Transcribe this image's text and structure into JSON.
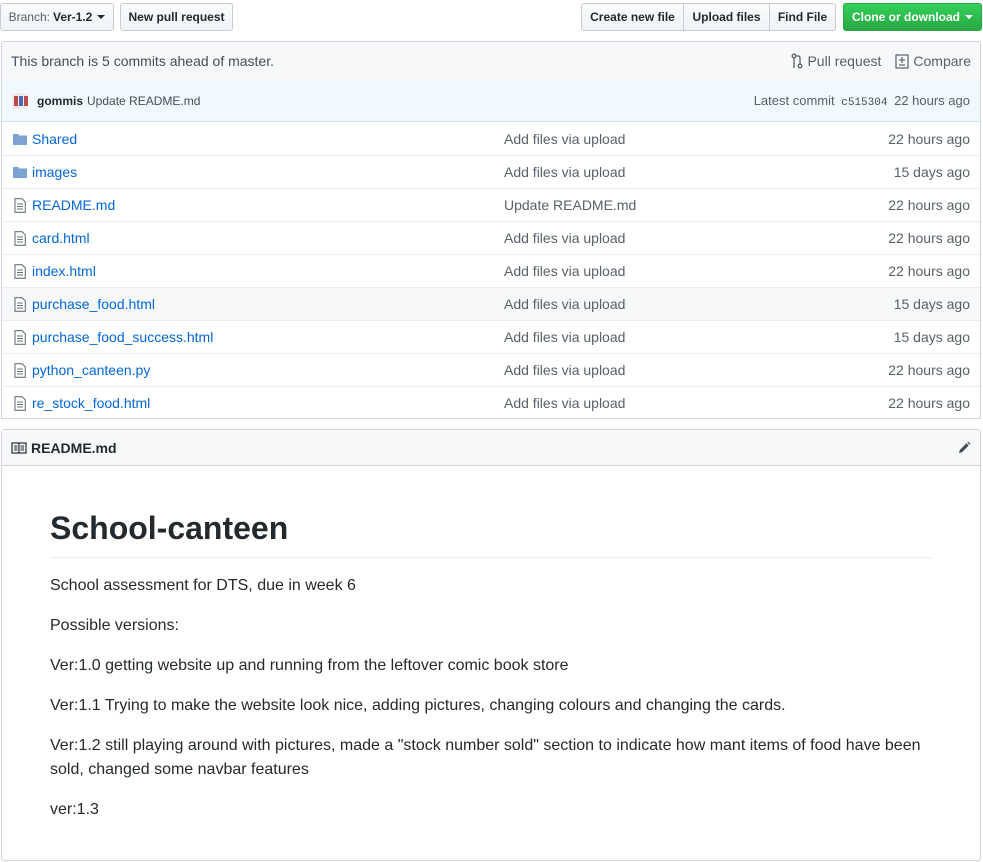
{
  "toolbar": {
    "branch_prefix": "Branch:",
    "branch_name": "Ver-1.2",
    "new_pr": "New pull request",
    "create_file": "Create new file",
    "upload_files": "Upload files",
    "find_file": "Find File",
    "clone": "Clone or download"
  },
  "branch_info": {
    "text": "This branch is 5 commits ahead of master.",
    "pull_request": "Pull request",
    "compare": "Compare"
  },
  "commit": {
    "author": "gommis",
    "message": "Update README.md",
    "latest_label": "Latest commit",
    "sha": "c515304",
    "age": "22 hours ago"
  },
  "files": [
    {
      "type": "folder",
      "name": "Shared",
      "message": "Add files via upload",
      "age": "22 hours ago"
    },
    {
      "type": "folder",
      "name": "images",
      "message": "Add files via upload",
      "age": "15 days ago"
    },
    {
      "type": "file",
      "name": "README.md",
      "message": "Update README.md",
      "age": "22 hours ago"
    },
    {
      "type": "file",
      "name": "card.html",
      "message": "Add files via upload",
      "age": "22 hours ago"
    },
    {
      "type": "file",
      "name": "index.html",
      "message": "Add files via upload",
      "age": "22 hours ago"
    },
    {
      "type": "file",
      "name": "purchase_food.html",
      "message": "Add files via upload",
      "age": "15 days ago"
    },
    {
      "type": "file",
      "name": "purchase_food_success.html",
      "message": "Add files via upload",
      "age": "15 days ago"
    },
    {
      "type": "file",
      "name": "python_canteen.py",
      "message": "Add files via upload",
      "age": "22 hours ago"
    },
    {
      "type": "file",
      "name": "re_stock_food.html",
      "message": "Add files via upload",
      "age": "22 hours ago"
    }
  ],
  "readme": {
    "filename": "README.md",
    "title": "School-canteen",
    "paragraphs": [
      "School assessment for DTS, due in week 6",
      "Possible versions:",
      "Ver:1.0 getting website up and running from the leftover comic book store",
      "Ver:1.1 Trying to make the website look nice, adding pictures, changing colours and changing the cards.",
      "Ver:1.2 still playing around with pictures, made a \"stock number sold\" section to indicate how mant items of food have been sold, changed some navbar features",
      "ver:1.3"
    ]
  },
  "colors": {
    "link": "#0366d6",
    "clone_button": "#28a745",
    "commit_bar": "#f1f8ff"
  }
}
